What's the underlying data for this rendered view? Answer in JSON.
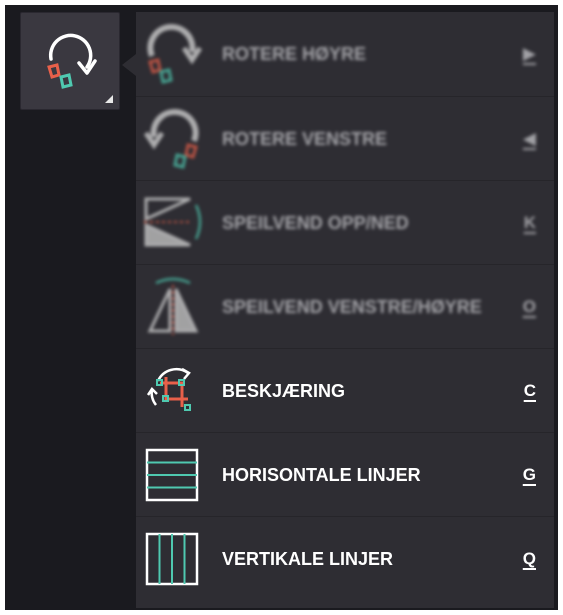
{
  "tool": {
    "icon": "rotate-tool-icon"
  },
  "menu": {
    "items": [
      {
        "label": "ROTERE HØYRE",
        "key": "▶",
        "icon": "rotate-right-icon",
        "enabled": false
      },
      {
        "label": "ROTERE VENSTRE",
        "key": "◀",
        "icon": "rotate-left-icon",
        "enabled": false
      },
      {
        "label": "SPEILVEND OPP/NED",
        "key": "K",
        "icon": "flip-vertical-icon",
        "enabled": false
      },
      {
        "label": "SPEILVEND VENSTRE/HØYRE",
        "key": "O",
        "icon": "flip-horizontal-icon",
        "enabled": false
      },
      {
        "label": "BESKJÆRING",
        "key": "C",
        "icon": "crop-icon",
        "enabled": true
      },
      {
        "label": "HORISONTALE LINJER",
        "key": "G",
        "icon": "horizontal-lines-icon",
        "enabled": true
      },
      {
        "label": "VERTIKALE LINJER",
        "key": "Q",
        "icon": "vertical-lines-icon",
        "enabled": true
      }
    ]
  },
  "colors": {
    "accent_red": "#e8604a",
    "accent_teal": "#4fc9b0",
    "menu_bg": "#2e2d33",
    "frame_bg": "#1a1a1f"
  }
}
